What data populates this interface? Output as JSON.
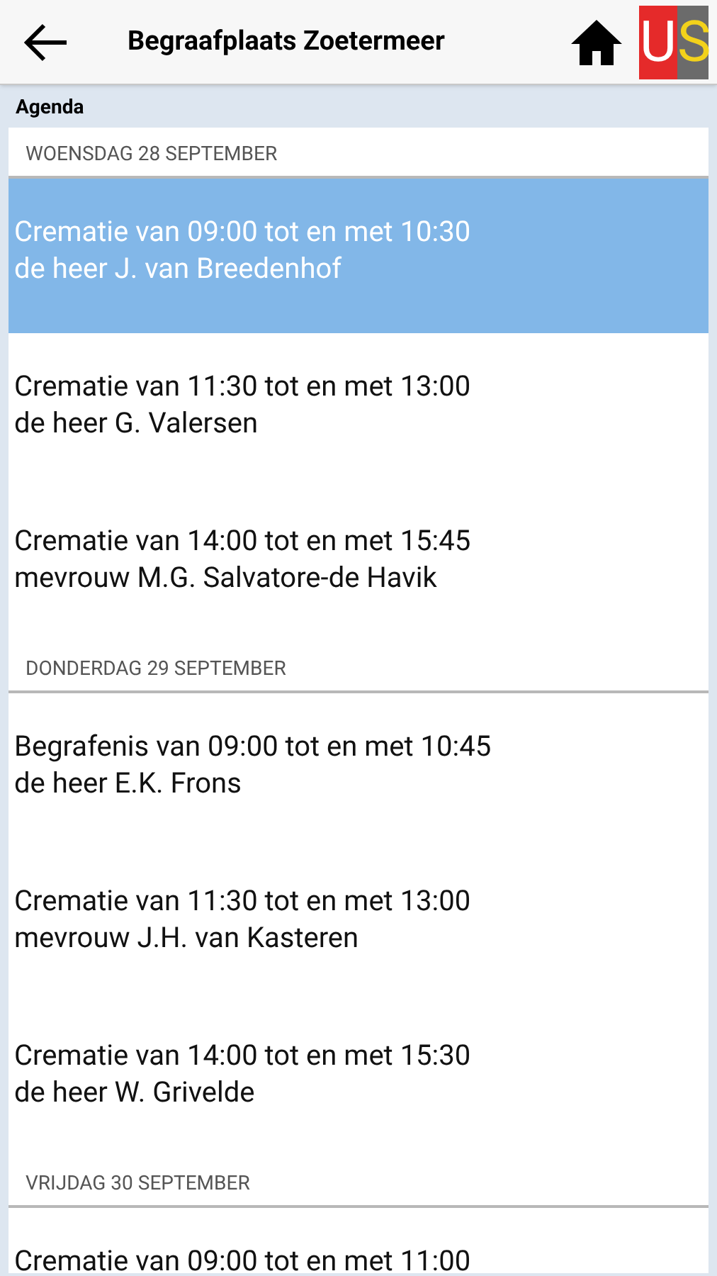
{
  "header": {
    "title": "Begraafplaats Zoetermeer",
    "logo": {
      "left": "U",
      "right": "S"
    }
  },
  "section_title": "Agenda",
  "days": [
    {
      "label": "WOENSDAG 28 SEPTEMBER",
      "events": [
        {
          "line1": "Crematie van 09:00 tot en met 10:30",
          "line2": "de heer J. van Breedenhof",
          "selected": true
        },
        {
          "line1": "Crematie van 11:30 tot en met 13:00",
          "line2": "de heer G. Valersen",
          "selected": false
        },
        {
          "line1": "Crematie van 14:00 tot en met 15:45",
          "line2": "mevrouw M.G. Salvatore-de Havik",
          "selected": false
        }
      ]
    },
    {
      "label": "DONDERDAG 29 SEPTEMBER",
      "events": [
        {
          "line1": "Begrafenis van 09:00 tot en met 10:45",
          "line2": "de heer E.K. Frons",
          "selected": false
        },
        {
          "line1": "Crematie van 11:30 tot en met 13:00",
          "line2": "mevrouw J.H. van Kasteren",
          "selected": false
        },
        {
          "line1": "Crematie van 14:00 tot en met 15:30",
          "line2": "de heer W. Grivelde",
          "selected": false
        }
      ]
    },
    {
      "label": "VRIJDAG 30 SEPTEMBER",
      "events": [
        {
          "line1": "Crematie van 09:00 tot en met 11:00",
          "selected": false
        }
      ]
    }
  ]
}
